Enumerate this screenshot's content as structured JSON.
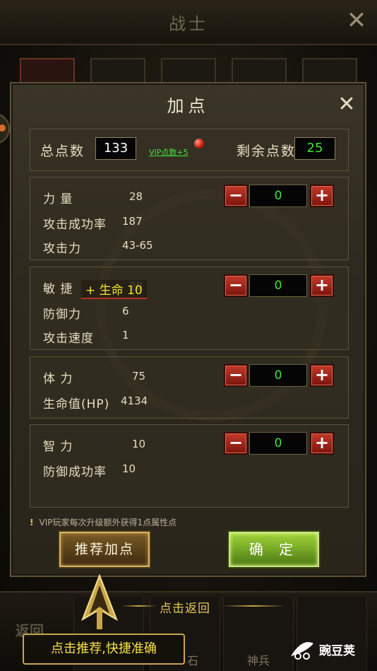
{
  "header": {
    "title": "战士",
    "close_glyph": "✕"
  },
  "dialog": {
    "title": "加点",
    "close_glyph": "✕",
    "summary": {
      "total_label": "总点数",
      "total_value": "133",
      "vip_bonus": "VIP点数+5",
      "remaining_label": "剩余点数",
      "remaining_value": "25"
    },
    "groups": [
      {
        "name": "力 量",
        "value": "28",
        "alloc": "0",
        "derived": [
          {
            "name": "攻击成功率",
            "value": "187"
          },
          {
            "name": "攻击力",
            "value": "43-65"
          }
        ]
      },
      {
        "name": "敏 捷",
        "value": "20",
        "alloc": "0",
        "float_tip": "+ 生命  10",
        "derived": [
          {
            "name": "防御力",
            "value": "6"
          },
          {
            "name": "攻击速度",
            "value": "1"
          }
        ]
      },
      {
        "name": "体 力",
        "value": "75",
        "alloc": "0",
        "derived": [
          {
            "name": "生命值(HP)",
            "value": "4134"
          }
        ]
      },
      {
        "name": "智 力",
        "value": "10",
        "alloc": "0",
        "derived": [
          {
            "name": "防御成功率",
            "value": "10"
          }
        ]
      }
    ],
    "minus_glyph": "−",
    "plus_glyph": "+",
    "vip_note": "VIP玩家每次升级额外获得1点属性点",
    "recommend_label": "推荐加点",
    "confirm_label": "确 定"
  },
  "bottom": {
    "back_left": "返回",
    "back_hint": "点击返回",
    "slot_labels": [
      "",
      "石",
      "神兵",
      ""
    ],
    "tooltip": "点击推荐,快捷准确"
  },
  "watermark": {
    "text": "豌豆荚"
  },
  "colors": {
    "green_value": "#3fe43a",
    "gold": "#c9a64a",
    "red_button": "#c23a2a",
    "confirm_green": "#9fd43a"
  }
}
